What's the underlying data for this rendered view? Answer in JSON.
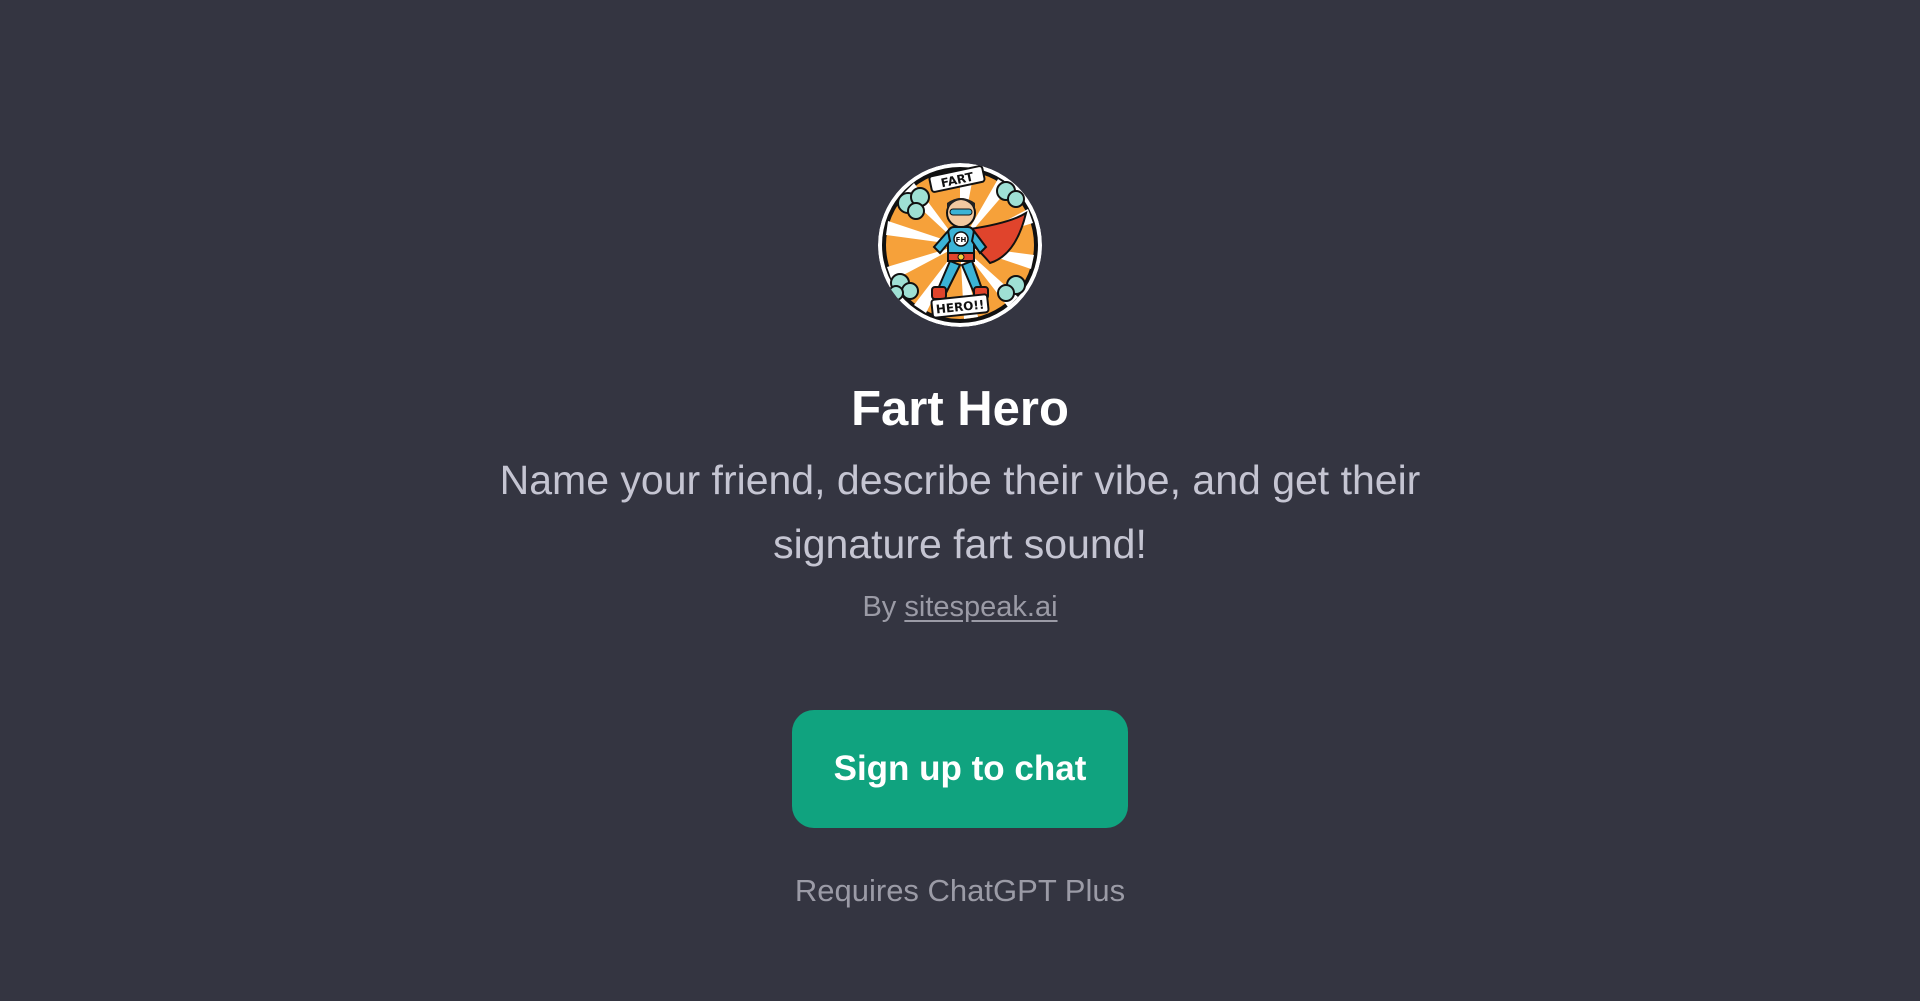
{
  "gpt": {
    "avatar_icon": "superhero-avatar-icon",
    "avatar_badge_top": "FART",
    "avatar_badge_bottom": "HERO!!",
    "avatar_chest": "FH",
    "name": "Fart Hero",
    "description": "Name your friend, describe their vibe, and get their signature fart sound!",
    "by_prefix": "By",
    "author": "sitespeak.ai"
  },
  "cta": {
    "label": "Sign up to chat"
  },
  "footer": {
    "requirement": "Requires ChatGPT Plus"
  },
  "colors": {
    "background": "#343541",
    "accent": "#10a37f"
  }
}
